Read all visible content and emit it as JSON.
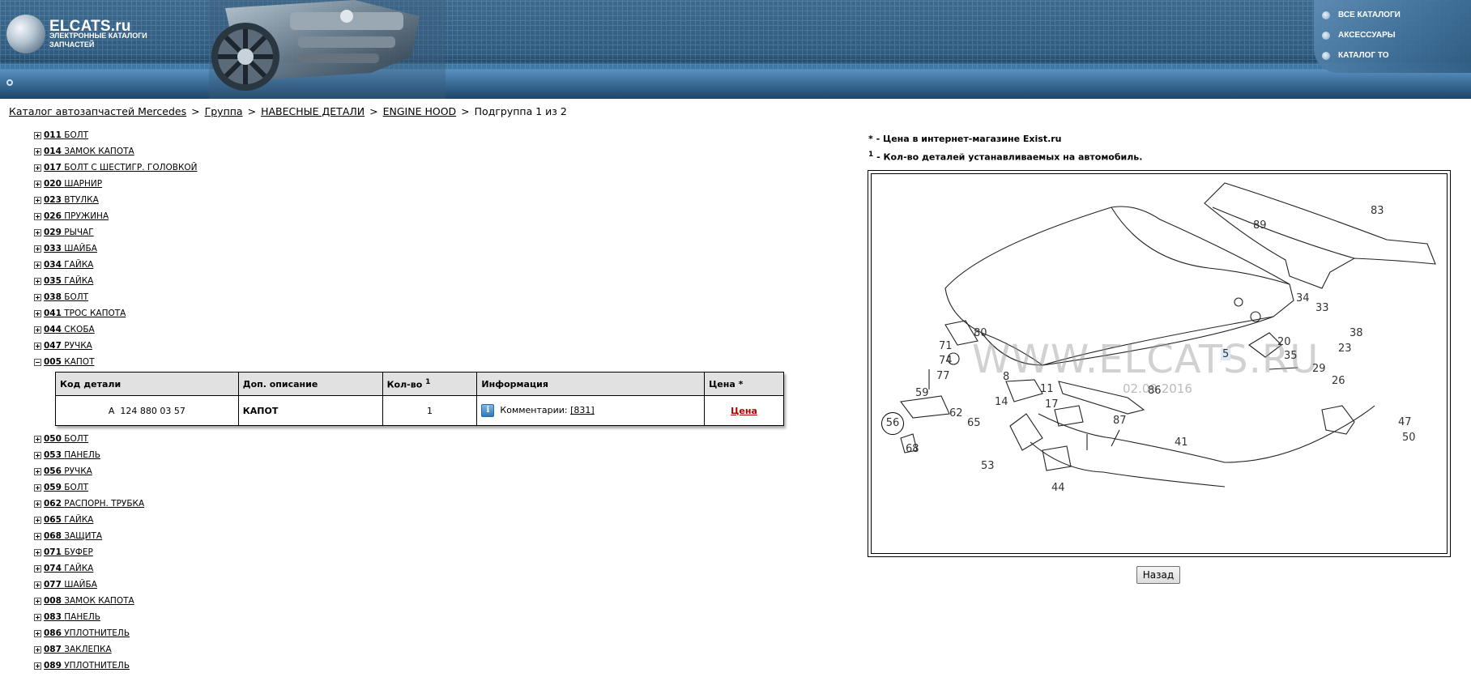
{
  "header": {
    "logo_title": "ELCATS.ru",
    "logo_subtitle": "ЭЛЕКТРОННЫЕ КАТАЛОГИ ЗАПЧАСТЕЙ",
    "menu": [
      "ВСЕ КАТАЛОГИ",
      "АКСЕССУАРЫ",
      "КАТАЛОГ ТО"
    ]
  },
  "breadcrumb": {
    "links": [
      "Каталог автозапчастей Mercedes",
      "Группа",
      "НАВЕСНЫЕ ДЕТАЛИ",
      "ENGINE HOOD"
    ],
    "current": "Подгруппа 1 из 2",
    "separator": ">"
  },
  "parts_before": [
    {
      "code": "011",
      "name": "БОЛТ"
    },
    {
      "code": "014",
      "name": "ЗАМОК КАПОТА"
    },
    {
      "code": "017",
      "name": "БОЛТ С ШЕСТИГР. ГОЛОВКОЙ"
    },
    {
      "code": "020",
      "name": "ШАРНИР"
    },
    {
      "code": "023",
      "name": "ВТУЛКА"
    },
    {
      "code": "026",
      "name": "ПРУЖИНА"
    },
    {
      "code": "029",
      "name": "РЫЧАГ"
    },
    {
      "code": "033",
      "name": "ШАЙБА"
    },
    {
      "code": "034",
      "name": "ГАЙКА"
    },
    {
      "code": "035",
      "name": "ГАЙКА"
    },
    {
      "code": "038",
      "name": "БОЛТ"
    },
    {
      "code": "041",
      "name": "ТРОС КАПОТА"
    },
    {
      "code": "044",
      "name": "СКОБА"
    },
    {
      "code": "047",
      "name": "РУЧКА"
    }
  ],
  "expanded_part": {
    "code": "005",
    "name": "КАПОТ"
  },
  "details_table": {
    "headers": [
      "Код детали",
      "Доп. описание",
      "Кол-во",
      "Информация",
      "Цена *"
    ],
    "qty_superscript": "1",
    "row": {
      "part_number": "A  124 880 03 57",
      "description": "КАПОТ",
      "qty": "1",
      "info_label": "Комментарии:",
      "info_link": "[831]",
      "price_link": "Цена"
    }
  },
  "parts_after": [
    {
      "code": "050",
      "name": "БОЛТ"
    },
    {
      "code": "053",
      "name": "ПАНЕЛЬ"
    },
    {
      "code": "056",
      "name": "РУЧКА"
    },
    {
      "code": "059",
      "name": "БОЛТ"
    },
    {
      "code": "062",
      "name": "РАСПОРН. ТРУБКА"
    },
    {
      "code": "065",
      "name": "ГАЙКА"
    },
    {
      "code": "068",
      "name": "ЗАЩИТА"
    },
    {
      "code": "071",
      "name": "БУФЕР"
    },
    {
      "code": "074",
      "name": "ГАЙКА"
    },
    {
      "code": "077",
      "name": "ШАЙБА"
    },
    {
      "code": "008",
      "name": "ЗАМОК КАПОТА"
    },
    {
      "code": "083",
      "name": "ПАНЕЛЬ"
    },
    {
      "code": "086",
      "name": "УПЛОТНИТЕЛЬ"
    },
    {
      "code": "087",
      "name": "ЗАКЛЕПКА"
    },
    {
      "code": "089",
      "name": "УПЛОТНИТЕЛЬ"
    }
  ],
  "notes": {
    "price_mark": "*",
    "price_note": " - Цена в интернет-магазине Exist.ru",
    "qty_mark": "1",
    "qty_note": " - Кол-во деталей устанавливаемых на автомобиль."
  },
  "diagram": {
    "watermark": "WWW.ELCATS.RU",
    "date": "02.09.2016",
    "callouts": [
      "89",
      "83",
      "34",
      "33",
      "38",
      "80",
      "71",
      "20",
      "23",
      "74",
      "35",
      "5",
      "29",
      "77",
      "26",
      "8",
      "11",
      "86",
      "59",
      "14",
      "17",
      "56",
      "62",
      "65",
      "87",
      "47",
      "68",
      "41",
      "50",
      "53",
      "44"
    ]
  },
  "back_button": "Назад"
}
